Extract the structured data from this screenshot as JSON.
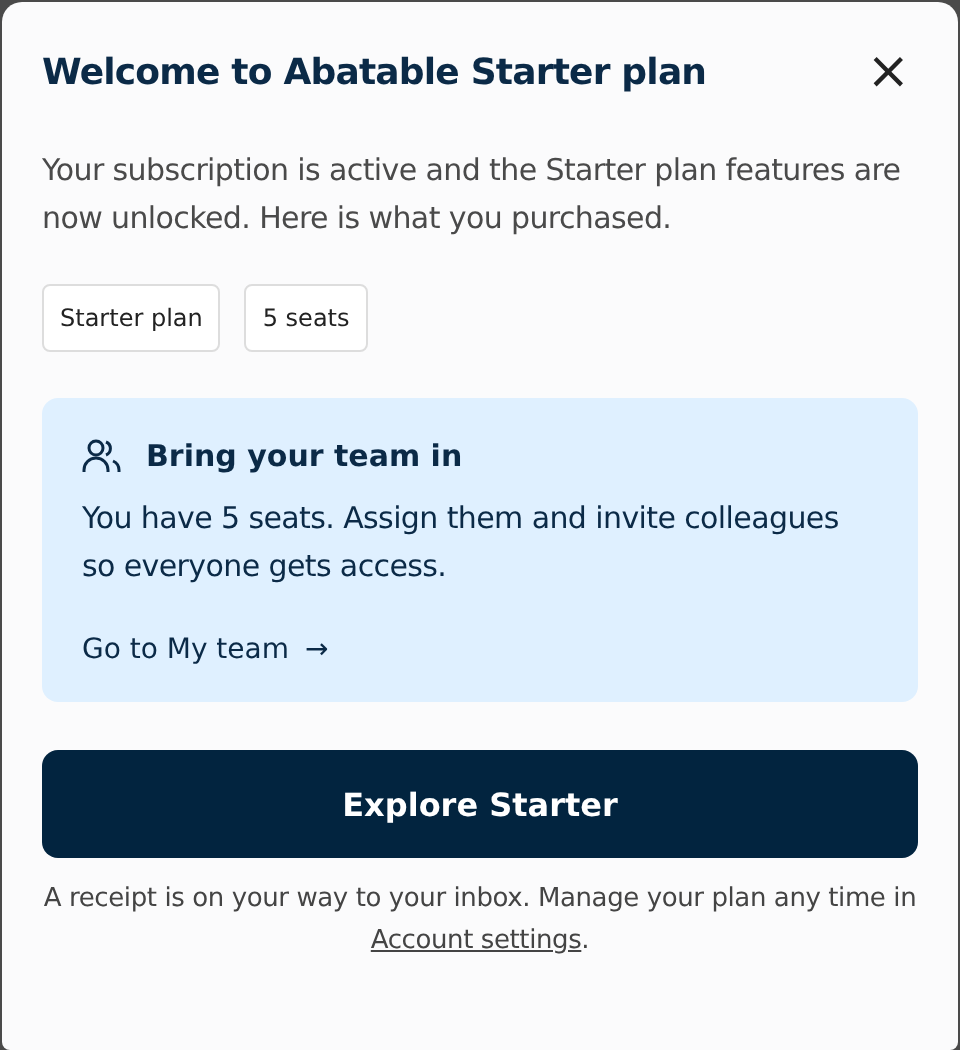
{
  "dialog": {
    "title": "Welcome to Abatable Starter plan",
    "close": "×",
    "intro": "Your subscription is active and the Starter plan features are now unlocked. Here is what you purchased.",
    "chips": [
      "Starter plan",
      "5 seats"
    ],
    "team_card": {
      "title": "Bring your team in",
      "body": "You have 5 seats. Assign them and invite colleagues so everyone gets access.",
      "link": "Go to My team",
      "link_arrow": "→"
    },
    "primary_button": "Explore Starter",
    "footer": {
      "text": "A receipt is on your way to your inbox. Manage your plan any time in ",
      "link": "Account settings",
      "end": "."
    }
  }
}
